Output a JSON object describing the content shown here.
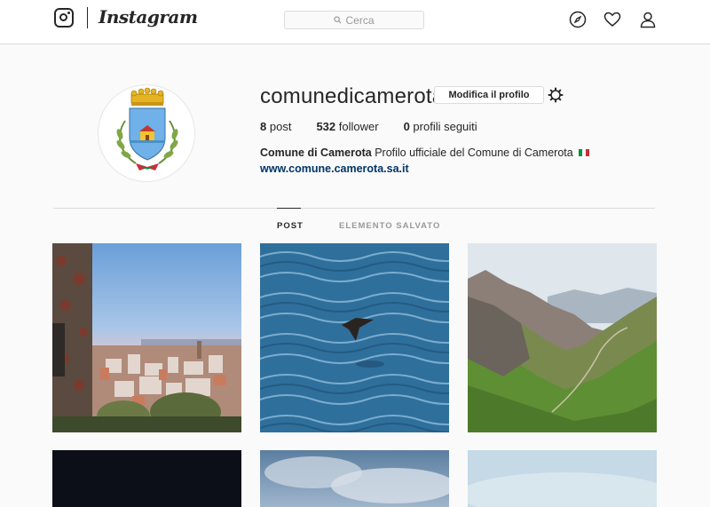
{
  "nav": {
    "logo_text": "Instagram",
    "search_placeholder": "Cerca",
    "icons": [
      "instagram-camera-icon",
      "search-icon",
      "compass-icon",
      "heart-icon",
      "person-icon"
    ]
  },
  "profile": {
    "username": "comunedicamerota",
    "edit_button": "Modifica il profilo",
    "settings_icon": "gear-icon",
    "stats": {
      "posts_count": "8",
      "posts_label": "post",
      "followers_count": "532",
      "followers_label": "follower",
      "following_count": "0",
      "following_label": "profili seguiti"
    },
    "full_name": "Comune di Camerota",
    "bio": "Profilo ufficiale del Comune di Camerota",
    "bio_flag_colors": [
      "#009246",
      "#ffffff",
      "#ce2b37"
    ],
    "website": "www.comune.camerota.sa.it"
  },
  "tabs": [
    {
      "label": "POST",
      "active": true
    },
    {
      "label": "ELEMENTO SALVATO",
      "active": false
    }
  ],
  "grid": {
    "posts": [
      {
        "subject": "coastal town at dusk"
      },
      {
        "subject": "bird flying over sea"
      },
      {
        "subject": "mountain valley landscape"
      },
      {
        "subject": "dark photo"
      },
      {
        "subject": "cloudy sky"
      },
      {
        "subject": "pale sky"
      }
    ]
  },
  "colors": {
    "link": "#003569",
    "border": "#dbdbdb",
    "background": "#fafafa",
    "text": "#262626",
    "muted": "#999999"
  }
}
